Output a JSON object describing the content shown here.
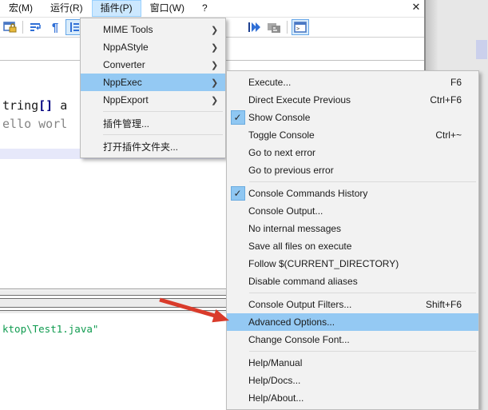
{
  "window": {
    "close_glyph": "✕"
  },
  "glyphs": {
    "check": "✓",
    "submenu_arrow": "❯",
    "pilcrow": "¶"
  },
  "menubar": {
    "items": [
      {
        "id": "macro",
        "label": "宏(M)"
      },
      {
        "id": "run",
        "label": "运行(R)"
      },
      {
        "id": "plugins",
        "label": "插件(P)",
        "active": true
      },
      {
        "id": "window",
        "label": "窗口(W)"
      },
      {
        "id": "help",
        "label": "?"
      }
    ]
  },
  "toolbar": {
    "icons": [
      {
        "id": "window-lock",
        "state": "normal"
      },
      {
        "id": "word-wrap",
        "state": "normal"
      },
      {
        "id": "show-all-characters",
        "state": "normal"
      },
      {
        "id": "indent-guide",
        "state": "active"
      },
      {
        "id": "run-previous",
        "state": "normal"
      },
      {
        "id": "dock-panel",
        "state": "disabled"
      },
      {
        "id": "show-console",
        "state": "active"
      }
    ]
  },
  "editor": {
    "code_lines": [
      {
        "segments": [
          {
            "text": "tring",
            "style": "plain"
          },
          {
            "text": "[]",
            "style": "bracket"
          },
          {
            "text": " a",
            "style": "plain"
          }
        ]
      },
      {
        "segments": [
          {
            "text": "ello worl",
            "style": "string"
          }
        ]
      }
    ]
  },
  "console": {
    "output_line": "ktop\\Test1.java\""
  },
  "plugin_menu": {
    "items": [
      {
        "id": "mime-tools",
        "label": "MIME Tools",
        "submenu": true
      },
      {
        "id": "nppastyle",
        "label": "NppAStyle",
        "submenu": true
      },
      {
        "id": "converter",
        "label": "Converter",
        "submenu": true
      },
      {
        "id": "nppexec",
        "label": "NppExec",
        "submenu": true,
        "highlighted": true
      },
      {
        "id": "nppexport",
        "label": "NppExport",
        "submenu": true
      },
      {
        "separator": true
      },
      {
        "id": "plugin-admin",
        "label": "插件管理..."
      },
      {
        "separator": true
      },
      {
        "id": "open-plugins-folder",
        "label": "打开插件文件夹..."
      }
    ]
  },
  "nppexec_menu": {
    "items": [
      {
        "id": "execute",
        "label": "Execute...",
        "shortcut": "F6"
      },
      {
        "id": "direct-execute-previous",
        "label": "Direct Execute Previous",
        "shortcut": "Ctrl+F6"
      },
      {
        "id": "show-console",
        "label": "Show Console",
        "checked": true
      },
      {
        "id": "toggle-console",
        "label": "Toggle Console",
        "shortcut": "Ctrl+~"
      },
      {
        "id": "go-to-next-error",
        "label": "Go to next error"
      },
      {
        "id": "go-to-previous-error",
        "label": "Go to previous error"
      },
      {
        "separator": true
      },
      {
        "id": "console-commands-history",
        "label": "Console Commands History",
        "checked": true
      },
      {
        "id": "console-output",
        "label": "Console Output..."
      },
      {
        "id": "no-internal-messages",
        "label": "No internal messages"
      },
      {
        "id": "save-all-files-on-execute",
        "label": "Save all files on execute"
      },
      {
        "id": "follow-current-directory",
        "label": "Follow $(CURRENT_DIRECTORY)"
      },
      {
        "id": "disable-command-aliases",
        "label": "Disable command aliases"
      },
      {
        "separator": true
      },
      {
        "id": "console-output-filters",
        "label": "Console Output Filters...",
        "shortcut": "Shift+F6"
      },
      {
        "id": "advanced-options",
        "label": "Advanced Options...",
        "highlighted": true
      },
      {
        "id": "change-console-font",
        "label": "Change Console Font..."
      },
      {
        "separator": true
      },
      {
        "id": "help-manual",
        "label": "Help/Manual"
      },
      {
        "id": "help-docs",
        "label": "Help/Docs..."
      },
      {
        "id": "help-about",
        "label": "Help/About..."
      }
    ]
  },
  "colors": {
    "menu_highlight": "#94c9f3",
    "menubar_active": "#cce8ff",
    "check_background": "#8fc7f2",
    "console_green": "#0f9b4f",
    "arrow_red": "#d93b2b",
    "code_bracket_navy": "#000080",
    "current_line": "#e6e8fa"
  }
}
